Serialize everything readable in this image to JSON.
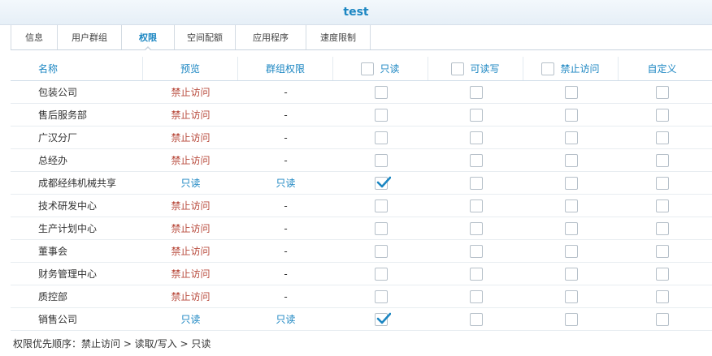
{
  "window": {
    "title": "test"
  },
  "tabs": [
    {
      "label": "信息",
      "active": false
    },
    {
      "label": "用户群组",
      "active": false
    },
    {
      "label": "权限",
      "active": true
    },
    {
      "label": "空间配额",
      "active": false
    },
    {
      "label": "应用程序",
      "active": false
    },
    {
      "label": "速度限制",
      "active": false
    }
  ],
  "table": {
    "headers": {
      "name": "名称",
      "preview": "预览",
      "group": "群组权限",
      "readonly": "只读",
      "readwrite": "可读写",
      "deny": "禁止访问",
      "custom": "自定义"
    },
    "rows": [
      {
        "name": "包装公司",
        "preview": "禁止访问",
        "group": "-",
        "ro": false
      },
      {
        "name": "售后服务部",
        "preview": "禁止访问",
        "group": "-",
        "ro": false
      },
      {
        "name": "广汉分厂",
        "preview": "禁止访问",
        "group": "-",
        "ro": false
      },
      {
        "name": "总经办",
        "preview": "禁止访问",
        "group": "-",
        "ro": false
      },
      {
        "name": "成都经纬机械共享",
        "preview": "只读",
        "group": "只读",
        "ro": true
      },
      {
        "name": "技术研发中心",
        "preview": "禁止访问",
        "group": "-",
        "ro": false
      },
      {
        "name": "生产计划中心",
        "preview": "禁止访问",
        "group": "-",
        "ro": false
      },
      {
        "name": "董事会",
        "preview": "禁止访问",
        "group": "-",
        "ro": false
      },
      {
        "name": "财务管理中心",
        "preview": "禁止访问",
        "group": "-",
        "ro": false
      },
      {
        "name": "质控部",
        "preview": "禁止访问",
        "group": "-",
        "ro": false
      },
      {
        "name": "销售公司",
        "preview": "只读",
        "group": "只读",
        "ro": true
      }
    ]
  },
  "footer": {
    "text": "权限优先顺序：禁止访问 > 读取/写入 > 只读"
  },
  "colors": {
    "accent": "#1b86c2",
    "deny": "#b84a3c"
  }
}
